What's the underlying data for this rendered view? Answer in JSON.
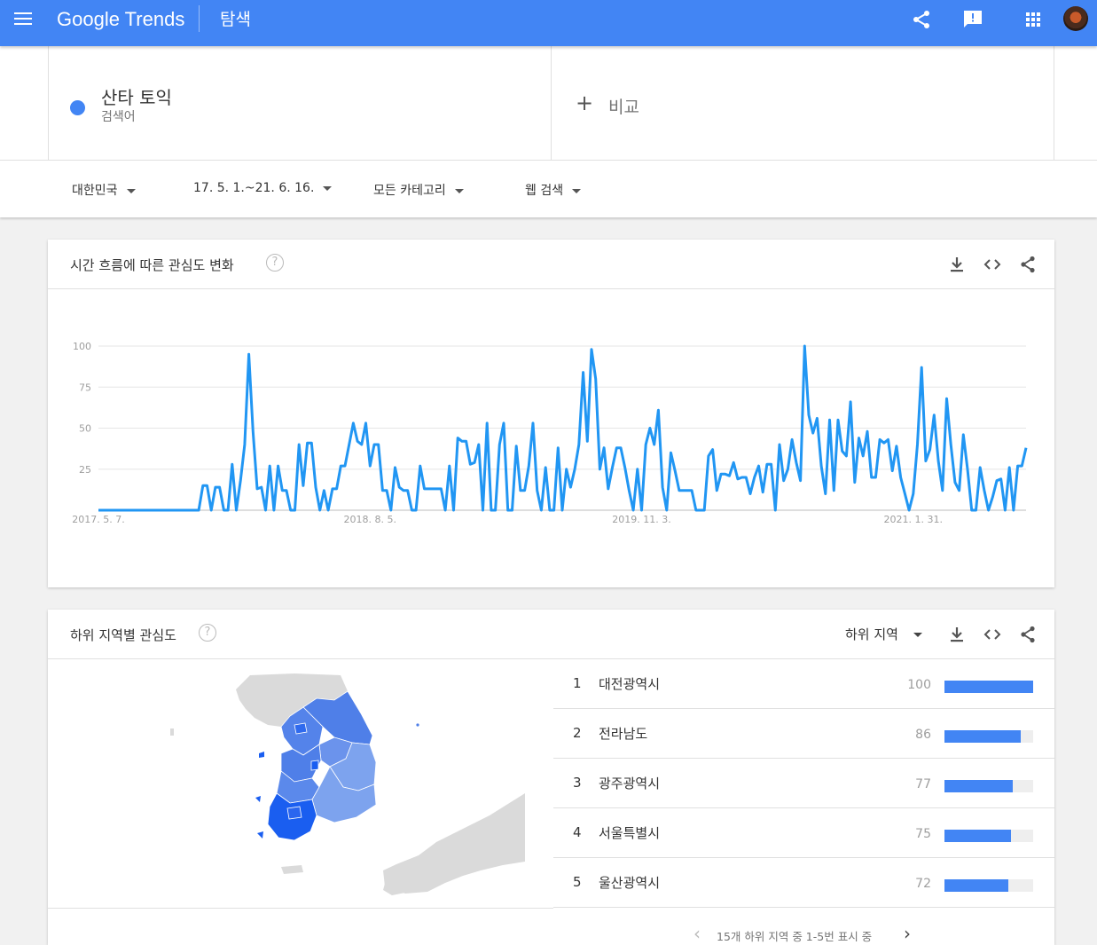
{
  "header": {
    "logo_google": "Google",
    "logo_trends": "Trends",
    "section_title": "탐색"
  },
  "search": {
    "term": "산타 토익",
    "term_type": "검색어",
    "compare_plus": "+",
    "compare_label": "비교"
  },
  "filters": {
    "region": "대한민국",
    "date_range": "17. 5. 1.~21. 6. 16.",
    "category": "모든 카테고리",
    "search_type": "웹 검색"
  },
  "interest_over_time": {
    "title": "시간 흐름에 따른 관심도 변화",
    "help": "?"
  },
  "chart_data": {
    "type": "line",
    "color": "#2196f3",
    "yticks": [
      100,
      75,
      50,
      25
    ],
    "ylim": [
      0,
      100
    ],
    "x_labels": [
      {
        "label": "2017. 5. 7.",
        "index": 0
      },
      {
        "label": "2018. 8. 5.",
        "index": 65
      },
      {
        "label": "2019. 11. 3.",
        "index": 130
      },
      {
        "label": "2021. 1. 31.",
        "index": 195
      }
    ],
    "series": [
      {
        "values": [
          0,
          0,
          0,
          0,
          0,
          0,
          0,
          0,
          0,
          0,
          0,
          0,
          0,
          0,
          0,
          0,
          0,
          0,
          0,
          0,
          0,
          0,
          0,
          0,
          0,
          15,
          15,
          0,
          14,
          14,
          0,
          0,
          28,
          0,
          18,
          40,
          95,
          48,
          13,
          14,
          0,
          27,
          0,
          27,
          12,
          12,
          0,
          0,
          40,
          15,
          41,
          41,
          14,
          0,
          12,
          0,
          13,
          13,
          27,
          27,
          40,
          53,
          42,
          40,
          53,
          27,
          40,
          40,
          12,
          12,
          0,
          26,
          14,
          12,
          12,
          0,
          0,
          27,
          13,
          13,
          13,
          13,
          13,
          0,
          27,
          0,
          44,
          42,
          42,
          28,
          29,
          40,
          0,
          53,
          0,
          0,
          40,
          53,
          0,
          0,
          39,
          12,
          12,
          27,
          53,
          12,
          0,
          26,
          0,
          0,
          38,
          0,
          25,
          14,
          25,
          40,
          84,
          42,
          98,
          80,
          25,
          38,
          13,
          26,
          38,
          38,
          26,
          12,
          0,
          25,
          0,
          40,
          50,
          40,
          61,
          14,
          0,
          35,
          24,
          12,
          12,
          12,
          12,
          0,
          0,
          0,
          33,
          37,
          12,
          22,
          22,
          21,
          29,
          19,
          20,
          20,
          10,
          20,
          27,
          11,
          28,
          28,
          0,
          40,
          18,
          25,
          43,
          29,
          18,
          100,
          58,
          47,
          56,
          27,
          10,
          55,
          12,
          55,
          36,
          33,
          66,
          17,
          44,
          33,
          48,
          20,
          20,
          43,
          41,
          43,
          24,
          39,
          20,
          10,
          0,
          10,
          40,
          87,
          30,
          37,
          58,
          30,
          12,
          68,
          40,
          17,
          12,
          46,
          25,
          0,
          0,
          26,
          12,
          0,
          8,
          18,
          19,
          0,
          26,
          0,
          27,
          27,
          38
        ]
      }
    ]
  },
  "subregion": {
    "title": "하위 지역별 관심도",
    "help": "?",
    "selector": "하위 지역",
    "rows": [
      {
        "rank": "1",
        "name": "대전광역시",
        "value": "100",
        "pct": 100
      },
      {
        "rank": "2",
        "name": "전라남도",
        "value": "86",
        "pct": 86
      },
      {
        "rank": "3",
        "name": "광주광역시",
        "value": "77",
        "pct": 77
      },
      {
        "rank": "4",
        "name": "서울특별시",
        "value": "75",
        "pct": 75
      },
      {
        "rank": "5",
        "name": "울산광역시",
        "value": "72",
        "pct": 72
      }
    ],
    "pager_prev": "‹",
    "pager_text": "15개 하위 지역 중 1-5번 표시 중",
    "pager_next": "›"
  },
  "colors": {
    "brand_blue": "#4285f4",
    "line_blue": "#2196f3",
    "map_dark": "#1a5ef0",
    "map_mid": "#4f7fe8",
    "map_light": "#7da3ee",
    "map_gray": "#dadada"
  }
}
